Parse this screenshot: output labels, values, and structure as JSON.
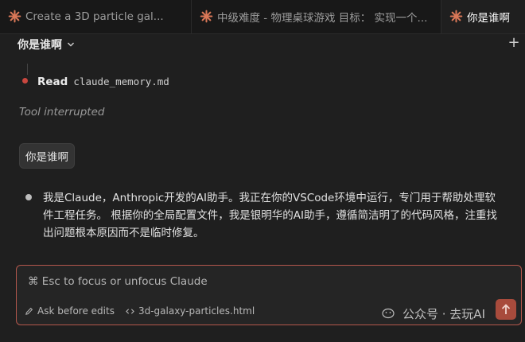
{
  "tabs": [
    {
      "label": "Create a 3D particle gal..."
    },
    {
      "label": "中级难度 - 物理桌球游戏 目标： 实现一个..."
    },
    {
      "label": "你是谁啊"
    }
  ],
  "header": {
    "title": "你是谁啊",
    "new_label": "+"
  },
  "messages": {
    "read_verb": "Read",
    "read_file": "claude_memory.md",
    "interrupted": "Tool interrupted",
    "user_question": "你是谁啊",
    "reply": "我是Claude，Anthropic开发的AI助手。我正在你的VSCode环境中运行，专门用于帮助处理软件工程任务。 根据你的全局配置文件，我是银明华的AI助手，遵循简洁明了的代码风格，注重找出问题根本原因而不是临时修复。"
  },
  "input": {
    "placeholder": "⌘ Esc to focus or unfocus Claude",
    "mode_label": "Ask before edits",
    "file_label": "3d-galaxy-particles.html"
  },
  "watermark": {
    "text": "公众号 · 去玩AI"
  },
  "colors": {
    "accent": "#d97757",
    "input_border": "#b4574c",
    "send_button": "#a84b3c",
    "status_dot": "#c9473f"
  },
  "icons": {
    "tab_icon": "claude-spark-icon",
    "send": "arrow-up-icon",
    "mode": "pencil-icon",
    "file": "code-icon"
  }
}
